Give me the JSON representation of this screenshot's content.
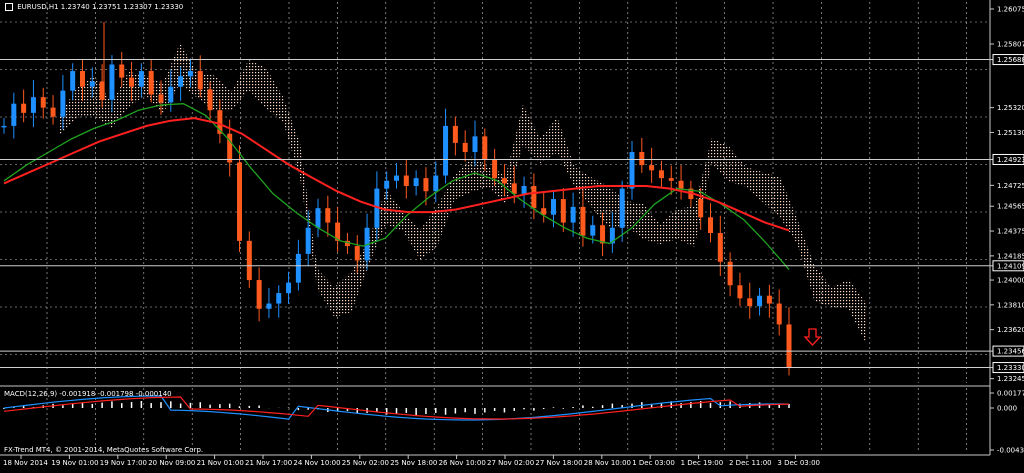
{
  "header": {
    "symbol_text": "EURUSD,H1",
    "ohlc_text": "1.23740 1.23751 1.23307 1.23330"
  },
  "macd": {
    "label": "MACD(12,26,9) -0.001918 -0.001798 -0.000140"
  },
  "copyright": "FX-Trend MT4, © 2001-2014, MetaQuotes Software Corp.",
  "colors": {
    "background": "#000000",
    "grid": "#c8c8c8",
    "bull_candle": "#1e90ff",
    "bear_candle": "#ff5a1e",
    "ma_red": "#ff2020",
    "ma_green": "#1fa31f",
    "cloud": "#ffdcc8",
    "macd_hist": "#ffffff",
    "arrow": "#ff2020"
  },
  "price_axis": {
    "ticks": [
      "1.26075",
      "1.25807",
      "1.25688",
      "1.25320",
      "1.25130",
      "1.24923",
      "1.24725",
      "1.24565",
      "1.24375",
      "1.24185",
      "1.24109",
      "1.24000",
      "1.23810",
      "1.23620",
      "1.23456",
      "1.23330",
      "1.23245"
    ],
    "highlighted": [
      "1.25688",
      "1.24923",
      "1.24109",
      "1.23456",
      "1.23330"
    ]
  },
  "macd_axis": {
    "ticks": [
      "0.001778",
      "0.000",
      "-0.004394"
    ]
  },
  "time_axis": {
    "labels": [
      "18 Nov 2014",
      "19 Nov 01:00",
      "19 Nov 17:00",
      "20 Nov 09:00",
      "21 Nov 01:00",
      "21 Nov 17:00",
      "24 Nov 10:00",
      "25 Nov 02:00",
      "25 Nov 18:00",
      "26 Nov 10:00",
      "27 Nov 02:00",
      "27 Nov 18:00",
      "28 Nov 10:00",
      "1 Dec 03:00",
      "1 Dec 19:00",
      "2 Dec 11:00",
      "3 Dec 03:00"
    ]
  },
  "chart_data": {
    "type": "candlestick",
    "symbol": "EURUSD",
    "timeframe": "H1",
    "ylim": [
      1.2324,
      1.2608
    ],
    "price_series": [
      1.2518,
      1.2535,
      1.2528,
      1.254,
      1.2532,
      1.2525,
      1.2545,
      1.256,
      1.2548,
      1.2552,
      1.2538,
      1.2565,
      1.2555,
      1.2548,
      1.256,
      1.2542,
      1.2536,
      1.2548,
      1.2556,
      1.256,
      1.2546,
      1.253,
      1.2512,
      1.249,
      1.243,
      1.24,
      1.2378,
      1.2382,
      1.239,
      1.2398,
      1.242,
      1.244,
      1.2455,
      1.2444,
      1.243,
      1.2426,
      1.2415,
      1.244,
      1.247,
      1.2476,
      1.248,
      1.2472,
      1.2478,
      1.2468,
      1.248,
      1.2518,
      1.2505,
      1.2498,
      1.251,
      1.2492,
      1.2478,
      1.2474,
      1.2466,
      1.2472,
      1.2455,
      1.245,
      1.2462,
      1.2444,
      1.2456,
      1.2434,
      1.2442,
      1.2428,
      1.244,
      1.247,
      1.2498,
      1.2488,
      1.2484,
      1.2478,
      1.2476,
      1.247,
      1.2462,
      1.2448,
      1.2436,
      1.2414,
      1.2396,
      1.2386,
      1.238,
      1.2388,
      1.2382,
      1.2366,
      1.2333
    ],
    "ma_red": [
      1.2474,
      1.2482,
      1.249,
      1.2498,
      1.2506,
      1.2512,
      1.2518,
      1.2522,
      1.2524,
      1.252,
      1.2512,
      1.25,
      1.2488,
      1.2478,
      1.2468,
      1.246,
      1.2454,
      1.2452,
      1.2452,
      1.2454,
      1.2458,
      1.2462,
      1.2466,
      1.2468,
      1.247,
      1.2472,
      1.2472,
      1.2472,
      1.247,
      1.2466,
      1.246,
      1.2452,
      1.2444,
      1.2438
    ],
    "ma_green": [
      1.2476,
      1.2488,
      1.2498,
      1.2508,
      1.2516,
      1.2522,
      1.253,
      1.2534,
      1.2535,
      1.2526,
      1.2508,
      1.2486,
      1.2466,
      1.2452,
      1.244,
      1.243,
      1.2426,
      1.2432,
      1.245,
      1.2464,
      1.2476,
      1.2482,
      1.2476,
      1.2462,
      1.245,
      1.244,
      1.2432,
      1.2428,
      1.244,
      1.2458,
      1.247,
      1.2468,
      1.2458,
      1.2446,
      1.2428,
      1.2408
    ]
  }
}
